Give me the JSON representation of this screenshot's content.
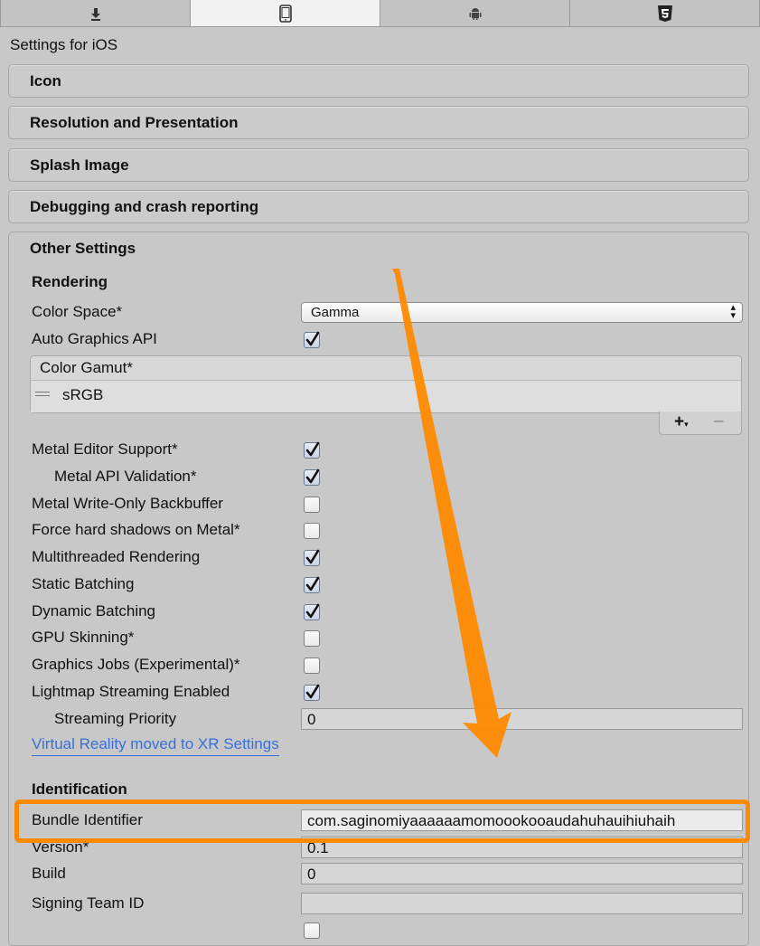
{
  "platform_tabs": [
    {
      "icon": "download-icon",
      "active": false
    },
    {
      "icon": "mobile-icon",
      "active": true
    },
    {
      "icon": "android-icon",
      "active": false
    },
    {
      "icon": "html5-icon",
      "active": false
    }
  ],
  "settings_title": "Settings for iOS",
  "sections": {
    "icon": "Icon",
    "resolution": "Resolution and Presentation",
    "splash": "Splash Image",
    "debugging": "Debugging and crash reporting",
    "other": "Other Settings"
  },
  "rendering": {
    "title": "Rendering",
    "color_space_label": "Color Space*",
    "color_space_value": "Gamma",
    "auto_graphics_label": "Auto Graphics API",
    "auto_graphics_checked": true,
    "color_gamut_header": "Color Gamut*",
    "color_gamut_items": [
      "sRGB"
    ],
    "metal_editor_label": "Metal Editor Support*",
    "metal_editor_checked": true,
    "metal_validation_label": "Metal API Validation*",
    "metal_validation_checked": true,
    "metal_write_label": "Metal Write-Only Backbuffer",
    "metal_write_checked": false,
    "force_shadows_label": "Force hard shadows on Metal*",
    "force_shadows_checked": false,
    "multithreaded_label": "Multithreaded Rendering",
    "multithreaded_checked": true,
    "static_batching_label": "Static Batching",
    "static_batching_checked": true,
    "dynamic_batching_label": "Dynamic Batching",
    "dynamic_batching_checked": true,
    "gpu_skinning_label": "GPU Skinning*",
    "gpu_skinning_checked": false,
    "graphics_jobs_label": "Graphics Jobs (Experimental)*",
    "graphics_jobs_checked": false,
    "lightmap_streaming_label": "Lightmap Streaming Enabled",
    "lightmap_streaming_checked": true,
    "streaming_priority_label": "Streaming Priority",
    "streaming_priority_value": "0",
    "vr_link": "Virtual Reality moved to XR Settings"
  },
  "identification": {
    "title": "Identification",
    "bundle_id_label": "Bundle Identifier",
    "bundle_id_value": "com.saginomiyaaaaaamomoookooaudahuhauihiuhaih",
    "version_label": "Version*",
    "version_value": "0.1",
    "build_label": "Build",
    "build_value": "0",
    "signing_team_label": "Signing Team ID",
    "signing_team_value": ""
  },
  "annotation": {
    "arrow_color": "#ff8a00",
    "highlight_color": "#ff8a00"
  }
}
